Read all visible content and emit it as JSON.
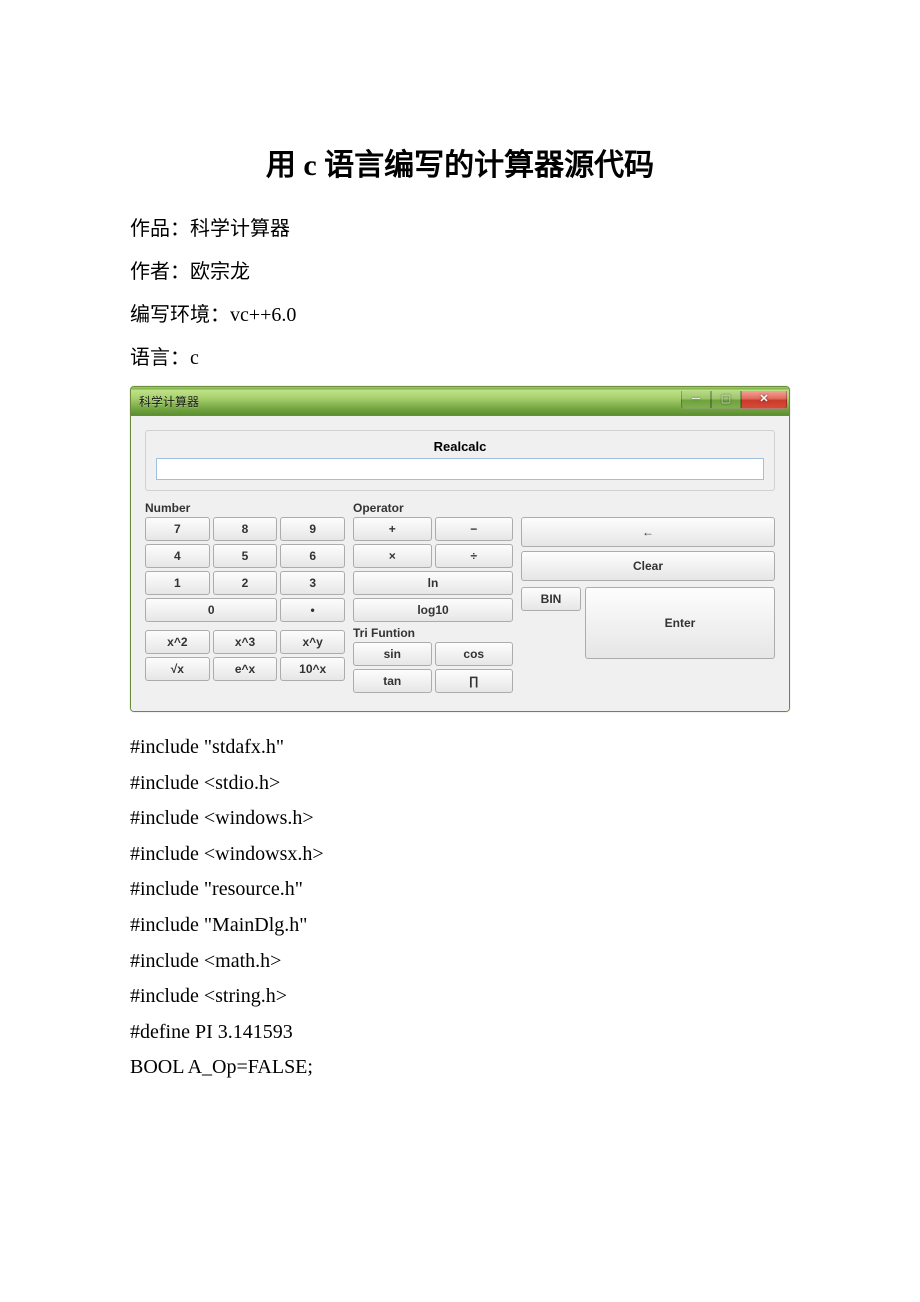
{
  "doc": {
    "title": "用 c 语言编写的计算器源代码",
    "meta": {
      "work_line": "作品：科学计算器",
      "author_line": "作者：欧宗龙",
      "env_line": "编写环境：vc++6.0",
      "lang_line": "语言：c"
    }
  },
  "app": {
    "window_title": "科学计算器",
    "realcalc_label": "Realcalc",
    "display_value": "",
    "sections": {
      "number": "Number",
      "operator": "Operator",
      "tri": "Tri Funtion"
    },
    "buttons": {
      "n7": "7",
      "n8": "8",
      "n9": "9",
      "n4": "4",
      "n5": "5",
      "n6": "6",
      "n1": "1",
      "n2": "2",
      "n3": "3",
      "n0": "0",
      "dot": "•",
      "plus": "+",
      "minus": "−",
      "mul": "×",
      "div": "÷",
      "ln": "ln",
      "log10": "log10",
      "sin": "sin",
      "cos": "cos",
      "tan": "tan",
      "pi": "∏",
      "x2": "x^2",
      "x3": "x^3",
      "xy": "x^y",
      "sqrt": "√x",
      "ex": "e^x",
      "tenx": "10^x",
      "back": "←",
      "clear": "Clear",
      "bin": "BIN",
      "enter": "Enter"
    }
  },
  "code_lines": [
    "#include \"stdafx.h\"",
    "#include <stdio.h>",
    "#include <windows.h>",
    "#include <windowsx.h>",
    "#include \"resource.h\"",
    "#include \"MainDlg.h\"",
    "#include <math.h>",
    "#include <string.h>",
    "#define PI 3.141593",
    "BOOL A_Op=FALSE;"
  ]
}
